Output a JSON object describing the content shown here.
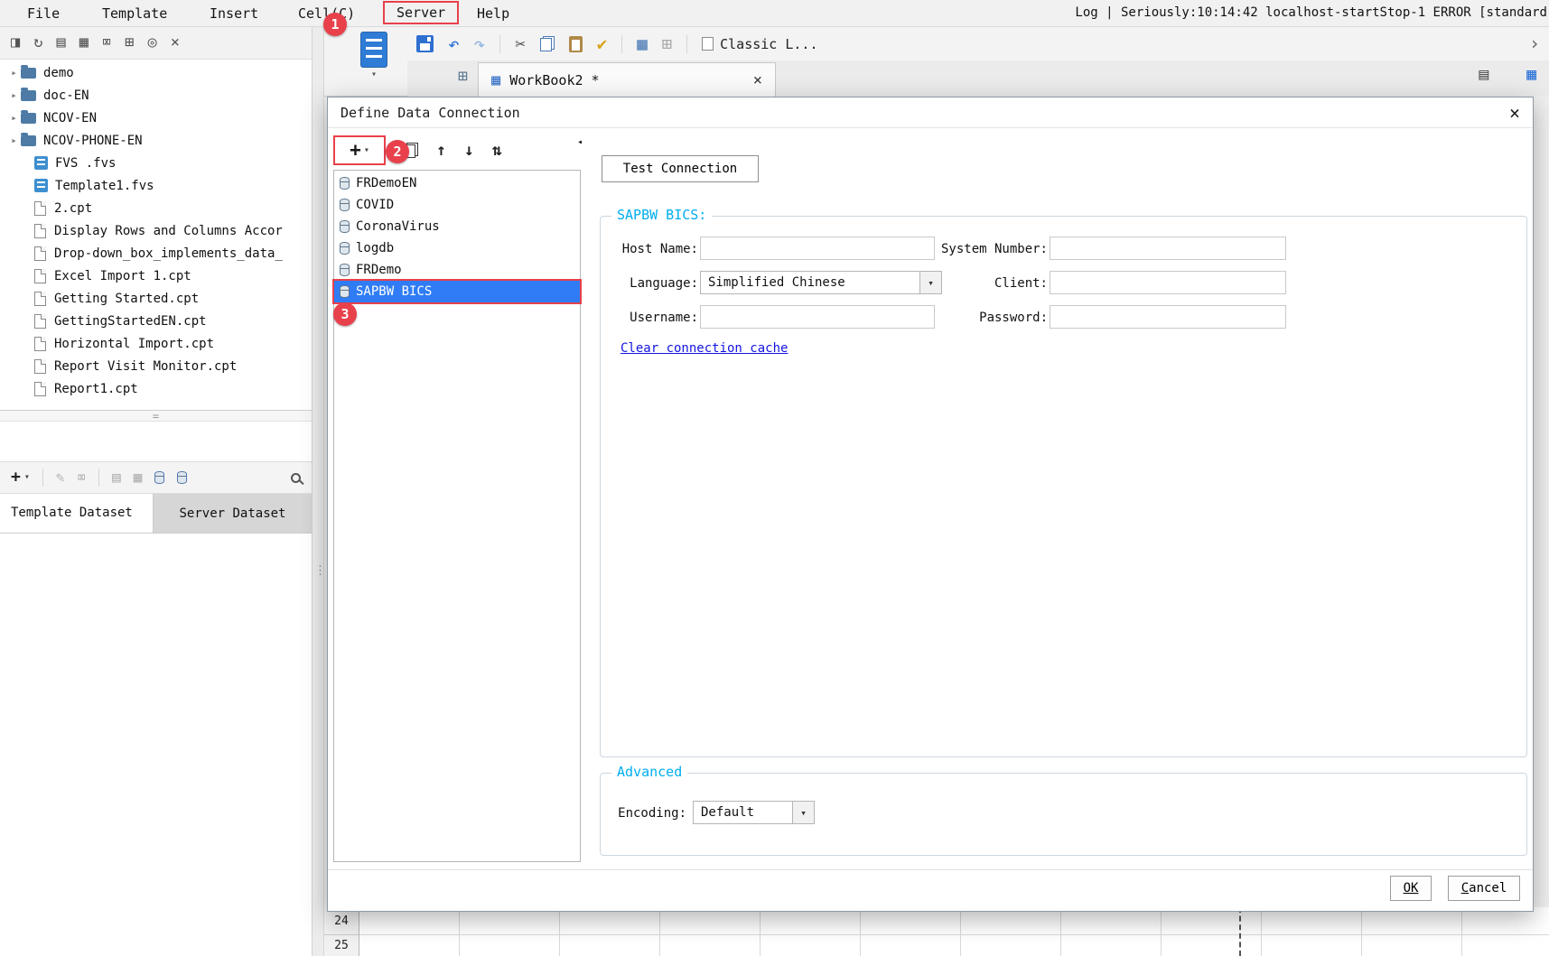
{
  "colors": {
    "accent_red": "#e8414b",
    "selection_blue": "#2f7cf6",
    "group_label_cyan": "#00aeef",
    "link_blue": "#1414e0"
  },
  "badges": {
    "step1": "1",
    "step2": "2",
    "step3": "3"
  },
  "menubar": {
    "items": [
      "File",
      "Template",
      "Insert",
      "Cell(C)",
      "Server",
      "Help"
    ],
    "log_text": "Log | Seriously:10:14:42 localhost-startStop-1 ERROR [standard"
  },
  "toolbar": {
    "style_dropdown_label": "Classic L..."
  },
  "tabbar": {
    "active_tab": "WorkBook2 *"
  },
  "tree": {
    "items": [
      {
        "label": "demo",
        "type": "folder"
      },
      {
        "label": "doc-EN",
        "type": "folder"
      },
      {
        "label": "NCOV-EN",
        "type": "folder"
      },
      {
        "label": "NCOV-PHONE-EN",
        "type": "folder"
      },
      {
        "label": "FVS .fvs",
        "type": "fvs"
      },
      {
        "label": "Template1.fvs",
        "type": "fvs"
      },
      {
        "label": "2.cpt",
        "type": "cpt"
      },
      {
        "label": "Display Rows and Columns Accor",
        "type": "cpt"
      },
      {
        "label": "Drop-down_box_implements_data_",
        "type": "cpt"
      },
      {
        "label": "Excel Import 1.cpt",
        "type": "cpt"
      },
      {
        "label": "Getting Started.cpt",
        "type": "cpt"
      },
      {
        "label": "GettingStartedEN.cpt",
        "type": "cpt"
      },
      {
        "label": "Horizontal Import.cpt",
        "type": "cpt"
      },
      {
        "label": "Report Visit Monitor.cpt",
        "type": "cpt"
      },
      {
        "label": "Report1.cpt",
        "type": "cpt"
      }
    ]
  },
  "dataset_panel": {
    "tabs": [
      {
        "label": "Template Dataset"
      },
      {
        "label": "Server Dataset"
      }
    ]
  },
  "dialog": {
    "title": "Define Data Connection",
    "list": {
      "items": [
        "FRDemoEN",
        "COVID",
        "CoronaVirus",
        "logdb",
        "FRDemo",
        "SAPBW BICS"
      ],
      "selected_index": 5,
      "selected_item": "SAPBW BICS"
    },
    "test_connection_button": "Test Connection",
    "connection_group": {
      "legend": "SAPBW BICS:",
      "host_name_label": "Host Name:",
      "host_name_value": "",
      "system_number_label": "System Number:",
      "system_number_value": "",
      "language_label": "Language:",
      "language_value": "Simplified Chinese",
      "client_label": "Client:",
      "client_value": "",
      "username_label": "Username:",
      "username_value": "",
      "password_label": "Password:",
      "password_value": "",
      "clear_cache_link": "Clear connection cache"
    },
    "advanced_group": {
      "legend": "Advanced",
      "encoding_label": "Encoding:",
      "encoding_value": "Default"
    },
    "buttons": {
      "ok": "OK",
      "cancel": "Cancel"
    }
  },
  "sheet": {
    "row_numbers": [
      "24",
      "25"
    ]
  },
  "icons": {
    "expand": "▸",
    "caret_down": "▾",
    "plus": "+",
    "up_arrow": "↑",
    "down_arrow": "↓",
    "sort": "⇅",
    "undo": "↶",
    "redo": "↷",
    "scissors": "✂",
    "brush": "✔",
    "refresh": "↻",
    "close": "×",
    "chevron_right": "›",
    "pencil": "✎",
    "trash": "⌧",
    "grid": "▦",
    "sheet": "▤",
    "target": "◎",
    "pane": "◨",
    "grid_plus": "⊞",
    "dots": "⋮",
    "collapse_left": "◂",
    "handle": "="
  }
}
